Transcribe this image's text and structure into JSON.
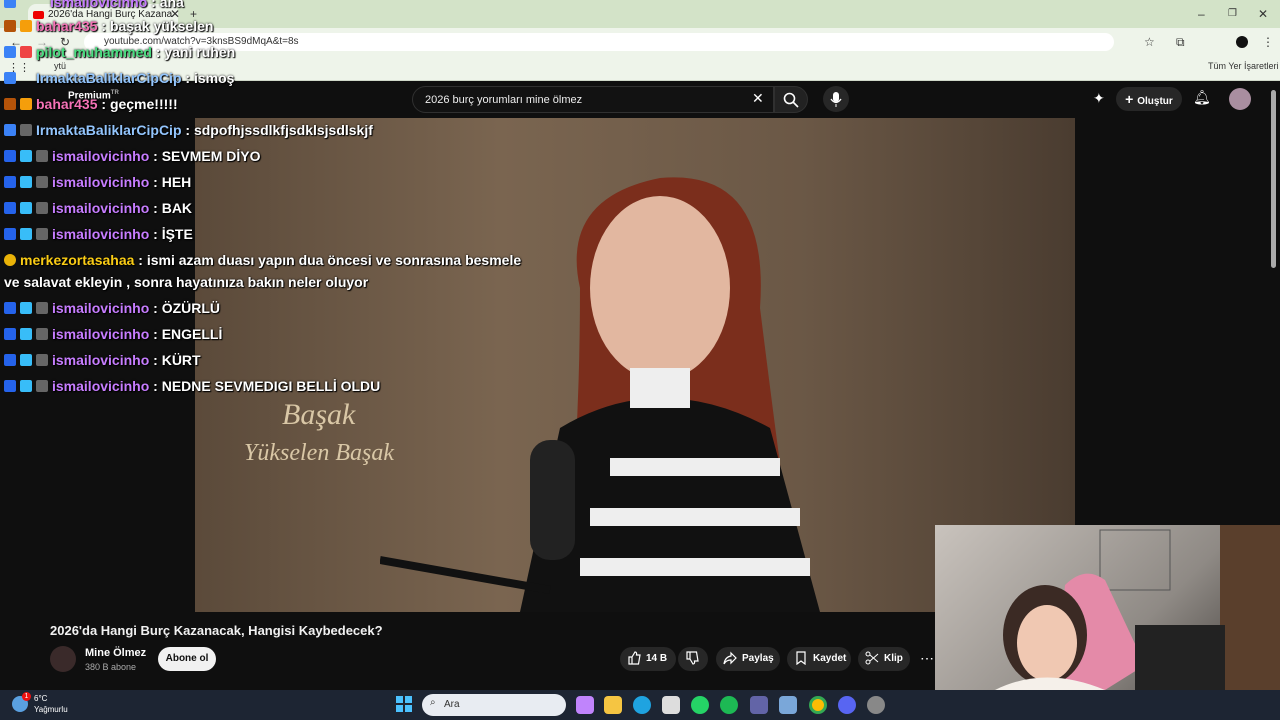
{
  "browser": {
    "tab_title": "2026'da Hangi Burç Kazana",
    "url": "youtube.com/watch?v=3knsBS9dMqA&t=8s",
    "bookmark_folder": "ytü",
    "all_bookmarks": "Tüm Yer İşaretleri"
  },
  "youtube": {
    "logo": "Premium",
    "logo_region": "TR",
    "search_value": "2026 burç yorumları mine ölmez",
    "create_label": "Oluştur",
    "video_overlay_title": "Başak",
    "video_overlay_subtitle": "Yükselen Başak",
    "video_title": "2026'da Hangi Burç Kazanacak, Hangisi Kaybedecek?",
    "channel_name": "Mine Ölmez",
    "channel_subs": "380 B abone",
    "subscribe_label": "Abone ol",
    "like_count": "14 B",
    "share_label": "Paylaş",
    "save_label": "Kaydet",
    "clip_label": "Klip",
    "accent": "#ff0000"
  },
  "chat": [
    {
      "user": "ismailovicinho",
      "msg": "ana"
    },
    {
      "user": "bahar435",
      "msg": "başak yükselen"
    },
    {
      "user": "pilot_muhammed",
      "msg": "yani ruhen"
    },
    {
      "user": "IrmaktaBaliklarCipCip",
      "msg": "ismoş"
    },
    {
      "user": "bahar435",
      "msg": "geçme!!!!!"
    },
    {
      "user": "IrmaktaBaliklarCipCip",
      "msg": "sdpofhjssdlkfjsdklsjsdlskjf"
    },
    {
      "user": "ismailovicinho",
      "msg": "SEVMEM DİYO"
    },
    {
      "user": "ismailovicinho",
      "msg": "HEH"
    },
    {
      "user": "ismailovicinho",
      "msg": "BAK"
    },
    {
      "user": "ismailovicinho",
      "msg": "İŞTE"
    },
    {
      "user": "merkezortasahaa",
      "msg": "ismi azam duası yapın dua öncesi ve sonrasına besmele"
    },
    {
      "user": "",
      "msg": "ve salavat ekleyin , sonra hayatınıza bakın neler oluyor"
    },
    {
      "user": "ismailovicinho",
      "msg": "ÖZÜRLÜ"
    },
    {
      "user": "ismailovicinho",
      "msg": "ENGELLİ"
    },
    {
      "user": "ismailovicinho",
      "msg": "KÜRT"
    },
    {
      "user": "ismailovicinho",
      "msg": "NEDNE SEVMEDIGI BELLİ OLDU"
    }
  ],
  "taskbar": {
    "weather_temp": "6°C",
    "weather_desc": "Yağmurlu",
    "search_placeholder": "Ara",
    "notification_count": "1"
  }
}
